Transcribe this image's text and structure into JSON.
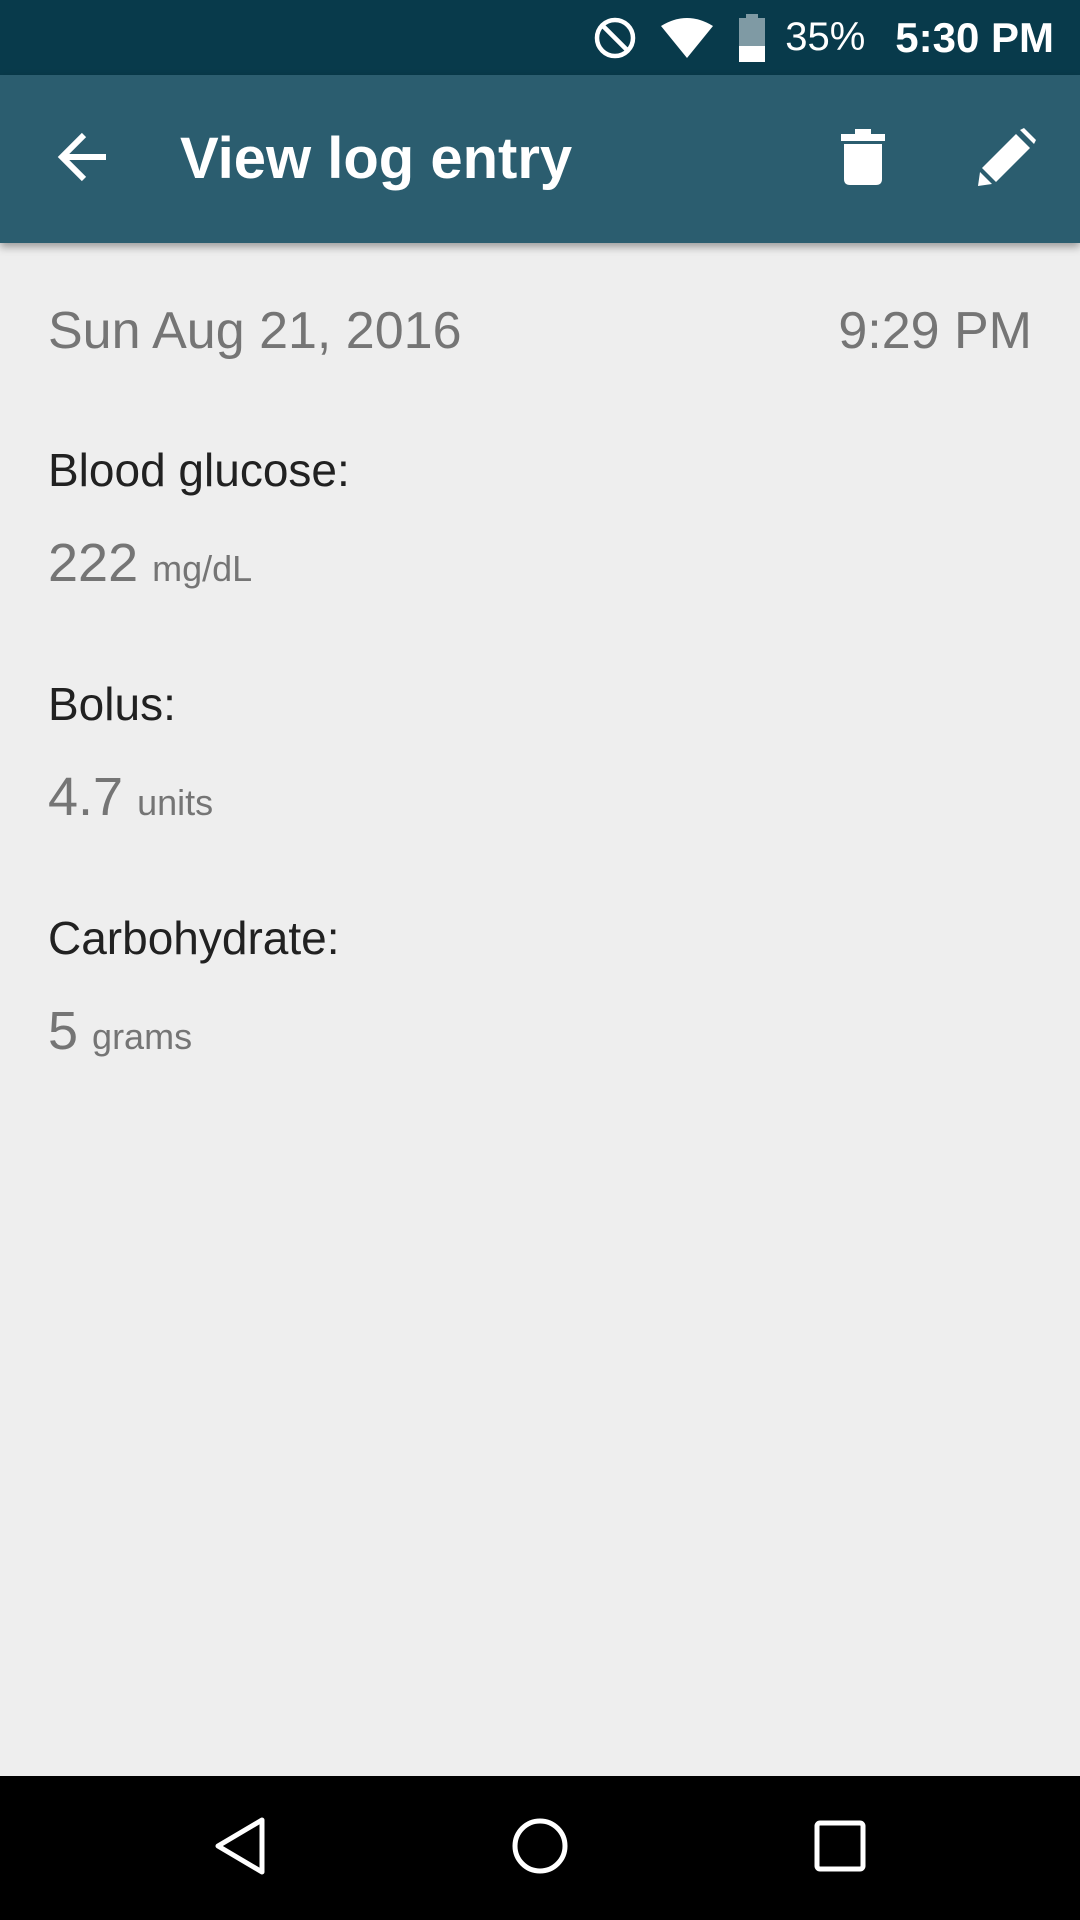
{
  "status_bar": {
    "icons": [
      "do-not-disturb-icon",
      "wifi-icon",
      "battery-icon"
    ],
    "battery": "35%",
    "time": "5:30 PM"
  },
  "app_bar": {
    "title": "View log entry",
    "back_icon": "arrow-back-icon",
    "delete_icon": "trash-icon",
    "edit_icon": "pencil-icon",
    "background_color": "#2b5d6f"
  },
  "entry": {
    "date": "Sun Aug 21, 2016",
    "time": "9:29 PM",
    "fields": [
      {
        "label": "Blood glucose:",
        "value": "222",
        "unit": "mg/dL"
      },
      {
        "label": "Bolus:",
        "value": "4.7",
        "unit": "units"
      },
      {
        "label": "Carbohydrate:",
        "value": "5",
        "unit": "grams"
      }
    ]
  },
  "nav_bar": {
    "icons": [
      "back-triangle-icon",
      "home-circle-icon",
      "recents-square-icon"
    ]
  }
}
